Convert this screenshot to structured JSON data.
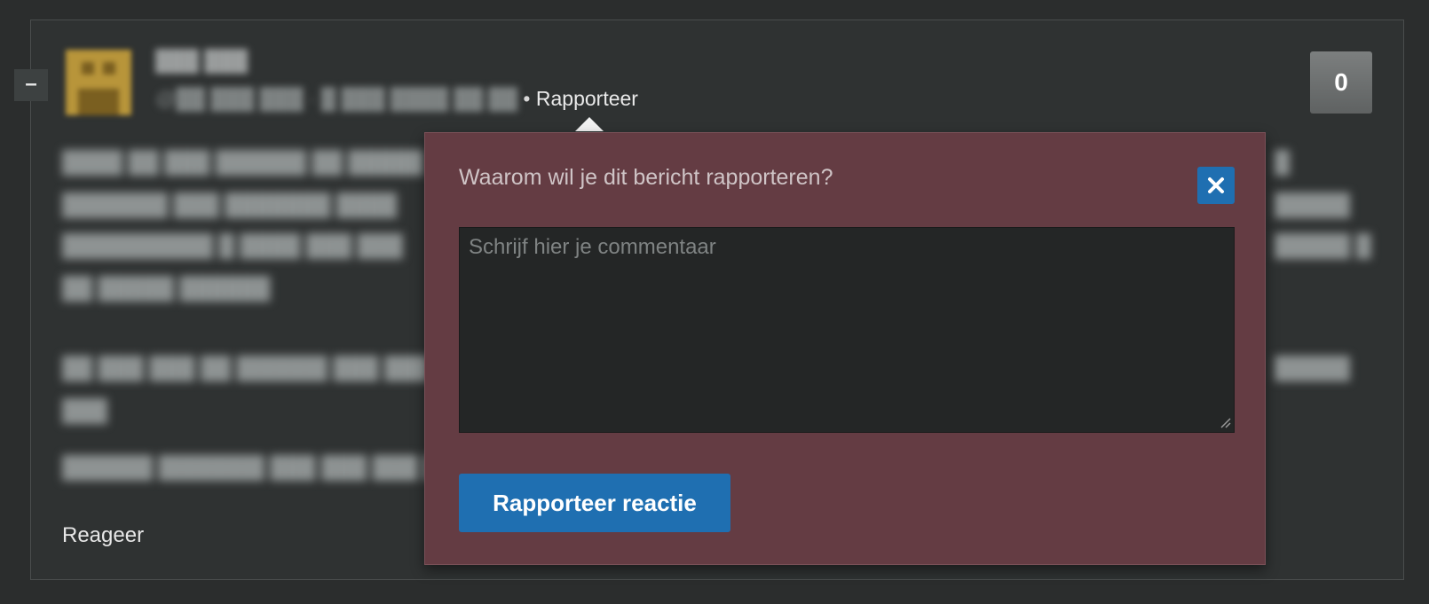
{
  "comment": {
    "collapse_label": "–",
    "username": "███ ███",
    "meta_date": "@██ ███ ███ · █ ███ ████ ██:██",
    "meta_separator": " • ",
    "report_label": "Rapporteer",
    "vote_count": "0",
    "reply_label": "Reageer",
    "body_lines": [
      "████ ██ ███ ██████ ██ █████",
      "███████ ███ ███████ ████",
      "██████████ █ ████ ███ ███",
      "██ █████ ██████",
      "██ ███ ███ ██ ██████ ███ ███",
      "███",
      "██████ ███████ ███ ███ ███ ██"
    ],
    "body_lines_right": [
      "█",
      "█████",
      "█████ █",
      "",
      "█████"
    ]
  },
  "report_popover": {
    "title": "Waarom wil je dit bericht rapporteren?",
    "textarea_placeholder": "Schrijf hier je commentaar",
    "textarea_value": "",
    "submit_label": "Rapporteer reactie",
    "close_icon": "close-icon"
  },
  "colors": {
    "popover_bg": "#643c43",
    "accent_blue": "#1f6fb1",
    "page_bg": "#2b2d2d"
  }
}
